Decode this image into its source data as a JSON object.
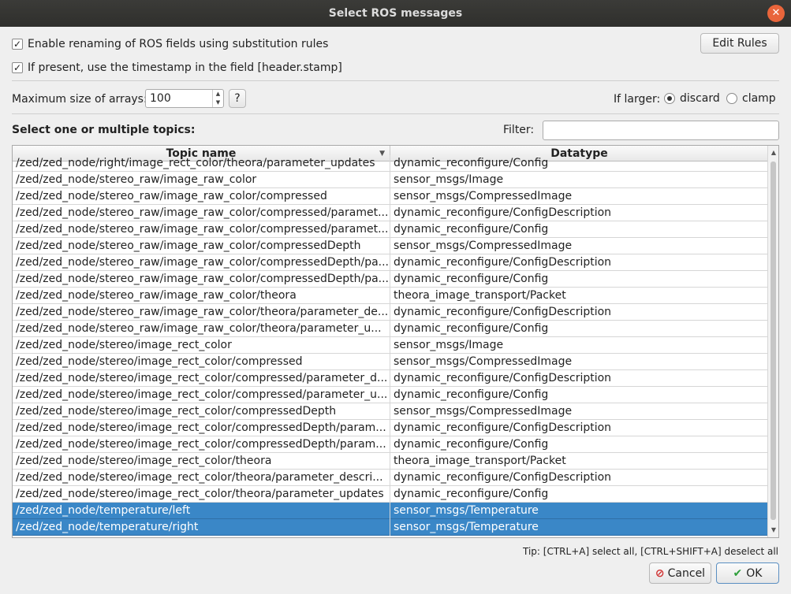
{
  "window": {
    "title": "Select ROS messages"
  },
  "options": {
    "rename_label": "Enable renaming of ROS fields using substitution rules",
    "rename_checked": true,
    "timestamp_label": "If present, use the timestamp in the field [header.stamp]",
    "timestamp_checked": true,
    "edit_rules_label": "Edit Rules",
    "max_array_label": "Maximum size of arrays:",
    "max_array_value": "100",
    "help_label": "?",
    "if_larger_label": "If larger:",
    "discard_label": "discard",
    "clamp_label": "clamp",
    "selected_mode": "discard"
  },
  "topics": {
    "heading": "Select one or multiple topics:",
    "filter_label": "Filter:",
    "filter_value": "",
    "columns": [
      "Topic name",
      "Datatype"
    ],
    "rows": [
      {
        "topic": "/zed/zed_node/right/image_rect_color/theora/parameter_updates",
        "type": "dynamic_reconfigure/Config",
        "selected": false
      },
      {
        "topic": "/zed/zed_node/stereo_raw/image_raw_color",
        "type": "sensor_msgs/Image",
        "selected": false
      },
      {
        "topic": "/zed/zed_node/stereo_raw/image_raw_color/compressed",
        "type": "sensor_msgs/CompressedImage",
        "selected": false
      },
      {
        "topic": "/zed/zed_node/stereo_raw/image_raw_color/compressed/paramet...",
        "type": "dynamic_reconfigure/ConfigDescription",
        "selected": false
      },
      {
        "topic": "/zed/zed_node/stereo_raw/image_raw_color/compressed/paramet...",
        "type": "dynamic_reconfigure/Config",
        "selected": false
      },
      {
        "topic": "/zed/zed_node/stereo_raw/image_raw_color/compressedDepth",
        "type": "sensor_msgs/CompressedImage",
        "selected": false
      },
      {
        "topic": "/zed/zed_node/stereo_raw/image_raw_color/compressedDepth/pa...",
        "type": "dynamic_reconfigure/ConfigDescription",
        "selected": false
      },
      {
        "topic": "/zed/zed_node/stereo_raw/image_raw_color/compressedDepth/pa...",
        "type": "dynamic_reconfigure/Config",
        "selected": false
      },
      {
        "topic": "/zed/zed_node/stereo_raw/image_raw_color/theora",
        "type": "theora_image_transport/Packet",
        "selected": false
      },
      {
        "topic": "/zed/zed_node/stereo_raw/image_raw_color/theora/parameter_de...",
        "type": "dynamic_reconfigure/ConfigDescription",
        "selected": false
      },
      {
        "topic": "/zed/zed_node/stereo_raw/image_raw_color/theora/parameter_u...",
        "type": "dynamic_reconfigure/Config",
        "selected": false
      },
      {
        "topic": "/zed/zed_node/stereo/image_rect_color",
        "type": "sensor_msgs/Image",
        "selected": false
      },
      {
        "topic": "/zed/zed_node/stereo/image_rect_color/compressed",
        "type": "sensor_msgs/CompressedImage",
        "selected": false
      },
      {
        "topic": "/zed/zed_node/stereo/image_rect_color/compressed/parameter_d...",
        "type": "dynamic_reconfigure/ConfigDescription",
        "selected": false
      },
      {
        "topic": "/zed/zed_node/stereo/image_rect_color/compressed/parameter_u...",
        "type": "dynamic_reconfigure/Config",
        "selected": false
      },
      {
        "topic": "/zed/zed_node/stereo/image_rect_color/compressedDepth",
        "type": "sensor_msgs/CompressedImage",
        "selected": false
      },
      {
        "topic": "/zed/zed_node/stereo/image_rect_color/compressedDepth/param...",
        "type": "dynamic_reconfigure/ConfigDescription",
        "selected": false
      },
      {
        "topic": "/zed/zed_node/stereo/image_rect_color/compressedDepth/param...",
        "type": "dynamic_reconfigure/Config",
        "selected": false
      },
      {
        "topic": "/zed/zed_node/stereo/image_rect_color/theora",
        "type": "theora_image_transport/Packet",
        "selected": false
      },
      {
        "topic": "/zed/zed_node/stereo/image_rect_color/theora/parameter_descri...",
        "type": "dynamic_reconfigure/ConfigDescription",
        "selected": false
      },
      {
        "topic": "/zed/zed_node/stereo/image_rect_color/theora/parameter_updates",
        "type": "dynamic_reconfigure/Config",
        "selected": false
      },
      {
        "topic": "/zed/zed_node/temperature/left",
        "type": "sensor_msgs/Temperature",
        "selected": true
      },
      {
        "topic": "/zed/zed_node/temperature/right",
        "type": "sensor_msgs/Temperature",
        "selected": true
      }
    ]
  },
  "footer": {
    "tip": "Tip: [CTRL+A] select all, [CTRL+SHIFT+A] deselect all",
    "cancel_label": "Cancel",
    "ok_label": "OK"
  },
  "colors": {
    "selection": "#3a87c7",
    "close": "#e9653b",
    "ok_check": "#2e9e3a",
    "cancel_icon": "#d03030"
  },
  "icons": {
    "close": "close-icon",
    "cancel": "cancel-icon",
    "ok": "check-icon",
    "sort": "sort-arrow-icon"
  }
}
